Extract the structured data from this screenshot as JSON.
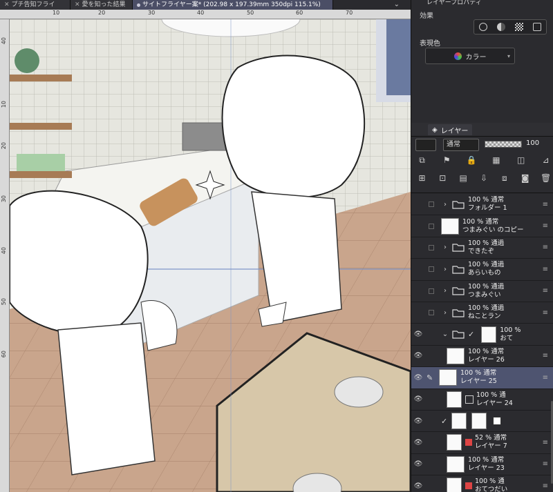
{
  "tabs": [
    {
      "label": "プチ告知フライ",
      "active": false
    },
    {
      "label": "愛を知った結果",
      "active": false
    },
    {
      "label": "サイトフライヤー案* (202.98 x 197.39mm 350dpi 115.1%)",
      "active": true
    }
  ],
  "ruler_top": [
    "10",
    "20",
    "30",
    "40",
    "50",
    "60",
    "70"
  ],
  "ruler_left": [
    "40",
    "10",
    "20",
    "30",
    "40",
    "50",
    "60"
  ],
  "panel": {
    "property_title": "レイヤープロパティ",
    "effect_label": "効果",
    "expression_label": "表現色",
    "color_button": "カラー",
    "layer_tab": "レイヤー",
    "blend_mode": "通常",
    "opacity": "100"
  },
  "layers": [
    {
      "line1": "100 %  通常",
      "line2": "フォルダー 1",
      "type": "folder",
      "selected": false
    },
    {
      "line1": "100 %  通常",
      "line2": "つまみぐい のコピー",
      "type": "thumb",
      "selected": false
    },
    {
      "line1": "100 %  通過",
      "line2": "できたぞ",
      "type": "folder",
      "selected": false
    },
    {
      "line1": "100 %  通過",
      "line2": "あらいもの",
      "type": "folder",
      "selected": false
    },
    {
      "line1": "100 %  通過",
      "line2": "つまみぐい",
      "type": "folder",
      "selected": false
    },
    {
      "line1": "100 %  通過",
      "line2": "ねことラン",
      "type": "folder",
      "selected": false
    },
    {
      "line1": "100 %",
      "line2": "おて",
      "type": "folder-open",
      "selected": false
    },
    {
      "line1": "100 %  通常",
      "line2": "レイヤー 26",
      "type": "thumb",
      "selected": false
    },
    {
      "line1": "100 %  通常",
      "line2": "レイヤー 25",
      "type": "thumb",
      "selected": true
    },
    {
      "line1": "100 %  通",
      "line2": "レイヤー 24",
      "type": "thumb",
      "selected": false
    },
    {
      "line1": "",
      "line2": "",
      "type": "mask",
      "selected": false
    },
    {
      "line1": "52 %  通常",
      "line2": "レイヤー 7",
      "type": "thumb",
      "selected": false
    },
    {
      "line1": "100 %  通常",
      "line2": "レイヤー 23",
      "type": "thumb",
      "selected": false
    },
    {
      "line1": "100 %  通",
      "line2": "おてつだい",
      "type": "thumb",
      "selected": false
    }
  ],
  "colors": {
    "accent": "#4e5470",
    "panel_bg": "#2b2b2f",
    "tab_active": "#4b4e66"
  },
  "icons": {
    "eye": "eye-icon",
    "folder": "folder-icon",
    "menu": "menu-icon"
  }
}
